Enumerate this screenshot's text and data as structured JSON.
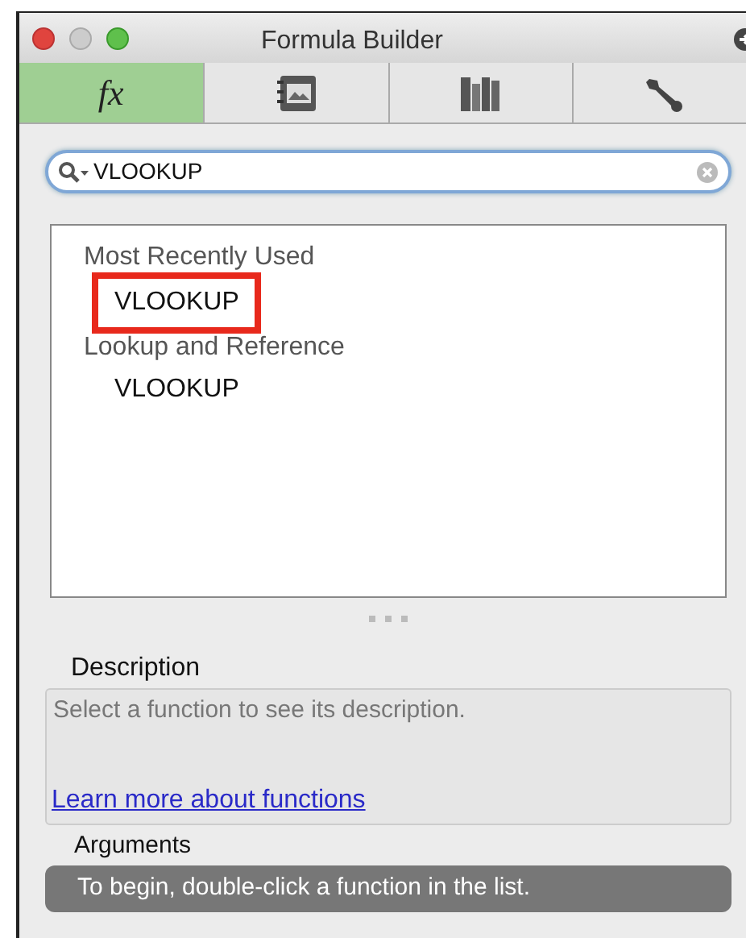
{
  "window": {
    "title": "Formula Builder"
  },
  "tabs": [
    {
      "kind": "text",
      "label": "fx",
      "selected": true
    },
    {
      "kind": "media",
      "selected": false
    },
    {
      "kind": "books",
      "selected": false
    },
    {
      "kind": "wrench",
      "selected": false
    }
  ],
  "search": {
    "value": "VLOOKUP"
  },
  "function_list": [
    {
      "heading": "Most Recently Used",
      "items": [
        {
          "label": "VLOOKUP",
          "highlighted": true
        }
      ]
    },
    {
      "heading": "Lookup and Reference",
      "items": [
        {
          "label": "VLOOKUP",
          "highlighted": false
        }
      ]
    }
  ],
  "description": {
    "label": "Description",
    "text": "Select a function to see its description.",
    "link": "Learn more about functions"
  },
  "arguments": {
    "label": "Arguments",
    "message": "To begin, double-click a function in the list."
  }
}
